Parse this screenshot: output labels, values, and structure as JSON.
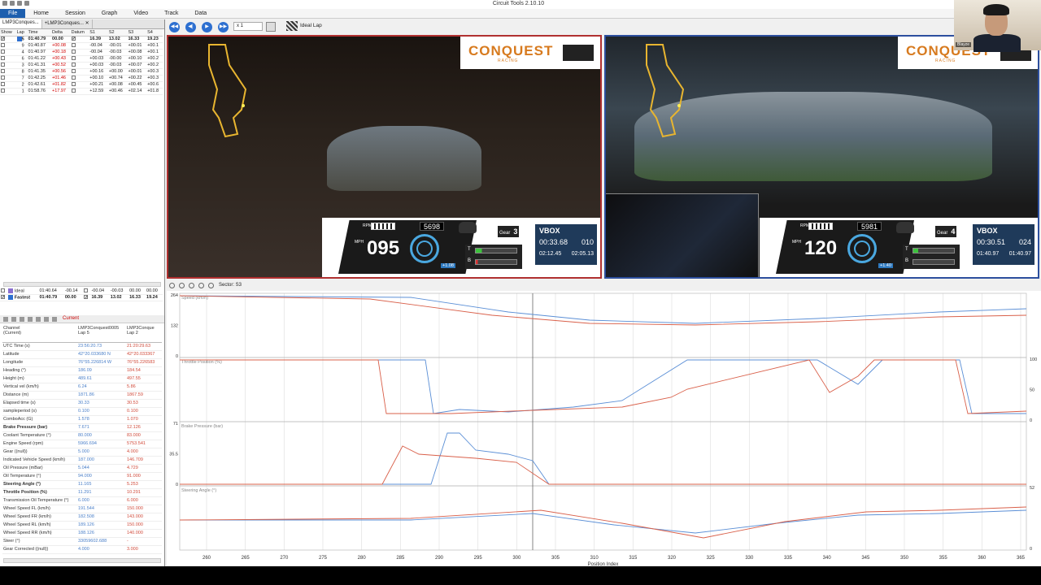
{
  "app": {
    "title": "Circuit Tools 2.10.10"
  },
  "menu": [
    "File",
    "Home",
    "Session",
    "Graph",
    "Video",
    "Track",
    "Data"
  ],
  "doc_tabs": [
    "LMP3Conques...",
    "+LMP3Conques..."
  ],
  "lap_table": {
    "headers": [
      "Show",
      "Lap",
      "Time",
      "Delta",
      "Datum",
      "S1",
      "S2",
      "S3",
      "S4"
    ],
    "rows": [
      {
        "lap": "5",
        "time": "01:40.79",
        "delta": "00.00",
        "s1": "16.39",
        "s2": "13.02",
        "s3": "16.33",
        "s4": "19.23",
        "checked": true
      },
      {
        "lap": "9",
        "time": "01:40.87",
        "delta": "+00.08",
        "s1": "-00.04",
        "s2": "-00.01",
        "s3": "+00.01",
        "s4": "+00.1"
      },
      {
        "lap": "4",
        "time": "01:40.97",
        "delta": "+00.18",
        "s1": "-00.04",
        "s2": "-00.03",
        "s3": "+00.08",
        "s4": "+00.1"
      },
      {
        "lap": "6",
        "time": "01:41.22",
        "delta": "+00.43",
        "s1": "+00.03",
        "s2": "-00.00",
        "s3": "+00.10",
        "s4": "+00.2"
      },
      {
        "lap": "3",
        "time": "01:41.31",
        "delta": "+00.52",
        "s1": "+00.03",
        "s2": "-00.03",
        "s3": "+00.07",
        "s4": "+00.2"
      },
      {
        "lap": "8",
        "time": "01:41.35",
        "delta": "+00.56",
        "s1": "+00.16",
        "s2": "+00.00",
        "s3": "+00.01",
        "s4": "+00.3"
      },
      {
        "lap": "7",
        "time": "01:42.25",
        "delta": "+01.46",
        "s1": "+00.10",
        "s2": "+00.74",
        "s3": "+00.22",
        "s4": "+00.3"
      },
      {
        "lap": "2",
        "time": "01:42.61",
        "delta": "+01.82",
        "s1": "+00.21",
        "s2": "+00.08",
        "s3": "+00.45",
        "s4": "+00.6"
      },
      {
        "lap": "1",
        "time": "01:58.76",
        "delta": "+17.97",
        "s1": "+12.59",
        "s2": "+00.46",
        "s3": "+02.14",
        "s4": "+01.8"
      }
    ]
  },
  "lap_summary": [
    {
      "label": "Ideal",
      "time": "01:40.64",
      "delta": "-00.14",
      "s1": "-00.04",
      "s2": "-00.03",
      "s3": "00.00",
      "s4": "00.00"
    },
    {
      "label": "Fastest",
      "time": "01:40.79",
      "delta": "00.00",
      "s1": "16.39",
      "s2": "13.02",
      "s3": "16.33",
      "s4": "19.24"
    }
  ],
  "channel_panel": {
    "current_label": "Current",
    "header": {
      "c1": "Channel",
      "c1b": "(Current)",
      "c2": "LMP3Conquest0005",
      "c2b": "Lap 5",
      "c3": "LMP3Conque",
      "c3b": "Lap 2"
    },
    "rows": [
      {
        "name": "UTC Time (s)",
        "v1": "23:56:20.73",
        "v2": "21:20:29.63"
      },
      {
        "name": "Latitude",
        "v1": "42°20.033680 N",
        "v2": "42°20.033367"
      },
      {
        "name": "Longitude",
        "v1": "76°55.226814 W",
        "v2": "76°55.226583"
      },
      {
        "name": "Heading (°)",
        "v1": "186.09",
        "v2": "184.54"
      },
      {
        "name": "Height (m)",
        "v1": "489.61",
        "v2": "497.55"
      },
      {
        "name": "Vertical vel (km/h)",
        "v1": "6.24",
        "v2": "5.86"
      },
      {
        "name": "Distance (m)",
        "v1": "1871.86",
        "v2": "1867.59"
      },
      {
        "name": "Elapsed time (s)",
        "v1": "30.33",
        "v2": "30.53"
      },
      {
        "name": "sampleperiod (s)",
        "v1": "0.100",
        "v2": "0.100"
      },
      {
        "name": "ComboAcc (G)",
        "v1": "1.578",
        "v2": "1.070"
      },
      {
        "name": "Brake Pressure (bar)",
        "v1": "7.671",
        "v2": "12.126",
        "bold": true
      },
      {
        "name": "Coolant Temperature (°)",
        "v1": "80.000",
        "v2": "83.000"
      },
      {
        "name": "Engine Speed (rpm)",
        "v1": "5966.694",
        "v2": "5753.541"
      },
      {
        "name": "Gear ((null))",
        "v1": "5.000",
        "v2": "4.000"
      },
      {
        "name": "Indicated Vehicle Speed (km/h)",
        "v1": "187.000",
        "v2": "146.709"
      },
      {
        "name": "Oil Pressure (mBar)",
        "v1": "5.044",
        "v2": "4.729"
      },
      {
        "name": "Oil Temperature (°)",
        "v1": "94.000",
        "v2": "91.000"
      },
      {
        "name": "Steering Angle (°)",
        "v1": "11.165",
        "v2": "5.253",
        "bold": true
      },
      {
        "name": "Throttle Position (%)",
        "v1": "11.291",
        "v2": "10.291",
        "bold": true
      },
      {
        "name": "Transmission Oil Temperature (°)",
        "v1": "6.000",
        "v2": "6.000"
      },
      {
        "name": "Wheel Speed FL (km/h)",
        "v1": "191.544",
        "v2": "150.000"
      },
      {
        "name": "Wheel Speed FR (km/h)",
        "v1": "182.508",
        "v2": "143.000"
      },
      {
        "name": "Wheel Speed RL (km/h)",
        "v1": "189.126",
        "v2": "150.000"
      },
      {
        "name": "Wheel Speed RR (km/h)",
        "v1": "188.126",
        "v2": "140.000"
      },
      {
        "name": "Steer (°)",
        "v1": "33059602.688",
        "v2": "-"
      },
      {
        "name": "Gear Corrected ((null))",
        "v1": "4.000",
        "v2": "3.000"
      }
    ]
  },
  "playback": {
    "speed": "x 1",
    "ideal_lap": "Ideal Lap"
  },
  "video_left": {
    "brand": "CONQUEST",
    "brand_sub": "RACING",
    "rpm": "5698",
    "speed": "095",
    "speed_unit": "MPH",
    "rpm_label": "RPM",
    "gear_label": "Gear",
    "gear": "3",
    "g_delta": "+1.08",
    "vbox_title": "VBOX",
    "current": "00:33.68",
    "count": "010",
    "last": "02:12.45",
    "best": "02:05.13",
    "throttle_label": "T",
    "brake_label": "B"
  },
  "video_right": {
    "brand": "CONQUEST",
    "brand_sub": "RACING",
    "rpm": "5981",
    "speed": "120",
    "speed_unit": "MPH",
    "rpm_label": "RPM",
    "gear_label": "Gear",
    "gear": "4",
    "g_delta": "+1.40",
    "vbox_title": "VBOX",
    "current": "00:30.51",
    "count": "024",
    "last": "01:40.97",
    "best": "01:40.97",
    "throttle_label": "T",
    "brake_label": "B"
  },
  "webcam": {
    "name": "Blayze"
  },
  "graph": {
    "sector_label": "Sector: S3",
    "x_label": "Position Index",
    "x_ticks": [
      "260",
      "265",
      "270",
      "275",
      "280",
      "285",
      "290",
      "295",
      "300",
      "305",
      "310",
      "315",
      "320",
      "325",
      "330",
      "335",
      "340",
      "345",
      "350",
      "355",
      "360",
      "365"
    ],
    "panels": [
      {
        "title": "Speed (km/h)",
        "left_ticks": [
          "264",
          "132",
          "0"
        ],
        "right_ticks": []
      },
      {
        "title": "Throttle Position (%)",
        "left_ticks": [],
        "right_ticks": [
          "100",
          "50",
          "0"
        ]
      },
      {
        "title": "Brake Pressure (bar)",
        "left_ticks": [
          "71",
          "35.5",
          "0"
        ],
        "right_ticks": []
      },
      {
        "title": "Steering Angle (°)",
        "left_ticks": [],
        "right_ticks": [
          "52",
          "0"
        ]
      }
    ],
    "colors": {
      "lap_a": "#5b8fd6",
      "lap_b": "#d9604a"
    }
  }
}
